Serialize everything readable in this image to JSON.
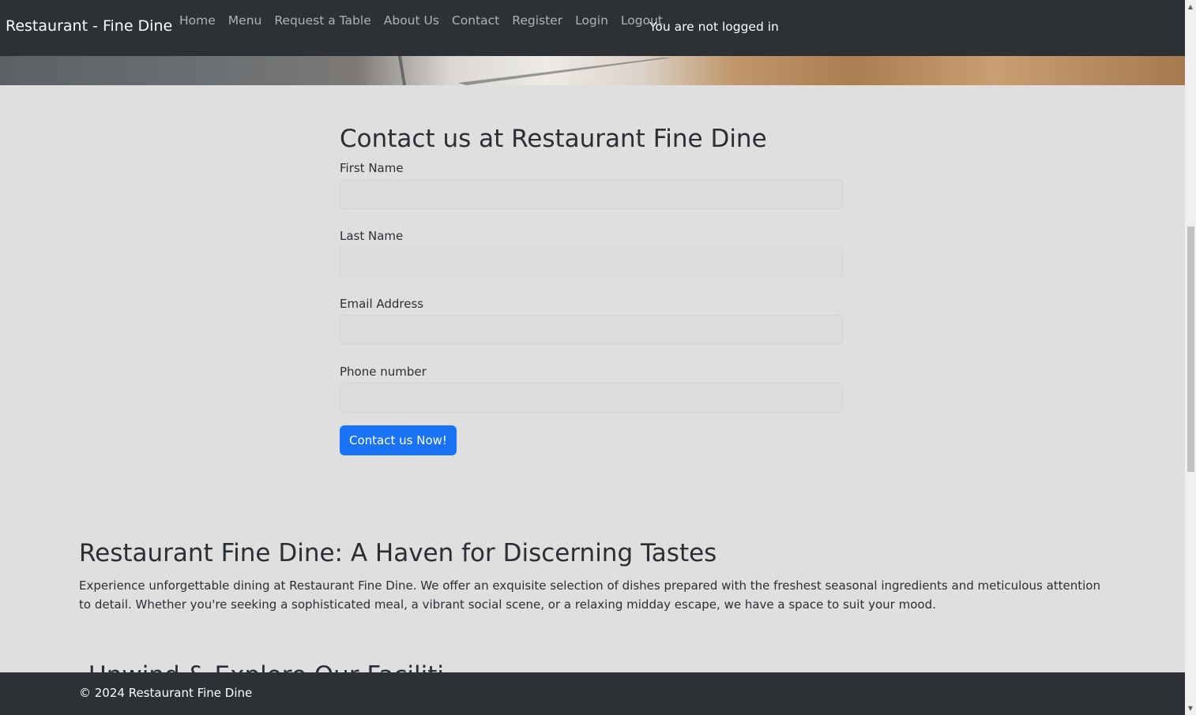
{
  "navbar": {
    "brand": "Restaurant - Fine Dine",
    "links": [
      "Home",
      "Menu",
      "Request a Table",
      "About Us",
      "Contact",
      "Register",
      "Login",
      "Logout"
    ],
    "login_status": "You are not logged in"
  },
  "contact_form": {
    "title": "Contact us at Restaurant Fine Dine",
    "fields": [
      {
        "label": "First Name",
        "value": ""
      },
      {
        "label": "Last Name",
        "value": ""
      },
      {
        "label": "Email Address",
        "value": ""
      },
      {
        "label": "Phone number",
        "value": ""
      }
    ],
    "submit_label": "Contact us Now!"
  },
  "about": {
    "title": "Restaurant Fine Dine: A Haven for Discerning Tastes",
    "text": "Experience unforgettable dining at Restaurant Fine Dine. We offer an exquisite selection of dishes prepared with the freshest seasonal ingredients and meticulous attention to detail. Whether you're seeking a sophisticated meal, a vibrant social scene, or a relaxing midday escape, we have a space to suit your mood."
  },
  "facilities": {
    "title_partial": "Unwind & Explore Our Faciliti"
  },
  "footer": {
    "text": "© 2024 Restaurant Fine Dine"
  },
  "scrollbar": {
    "up_icon": "triangle-up-icon",
    "down_icon": "triangle-down-icon",
    "up_glyph": "▲",
    "down_glyph": "▼"
  },
  "colors": {
    "navbar_bg": "#2d3034",
    "page_bg": "#dfdfe0",
    "primary_button": "#1a73f5"
  }
}
